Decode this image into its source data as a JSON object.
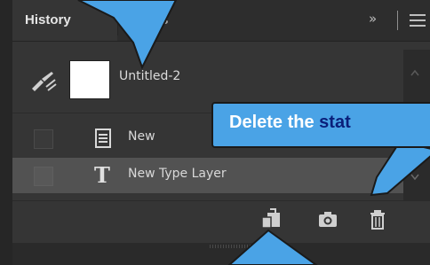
{
  "tabs": {
    "history_label": "History",
    "comments_label": "mments"
  },
  "panel_menu": {
    "collapse_label": "»"
  },
  "snapshot": {
    "name": "Untitled-2"
  },
  "history_items": [
    {
      "label": "New",
      "icon": "document-icon"
    },
    {
      "label": "New Type Layer",
      "icon": "type-tool-icon"
    }
  ],
  "footer_buttons": [
    {
      "name": "new-document-from-state-button",
      "icon": "new-document-icon"
    },
    {
      "name": "new-snapshot-button",
      "icon": "camera-icon"
    },
    {
      "name": "delete-state-button",
      "icon": "trash-icon"
    }
  ],
  "callout": {
    "text_prefix": "Delete the ",
    "text_highlight": "stat"
  },
  "colors": {
    "panel_bg": "#353535",
    "selected_row_bg": "#525252",
    "callout_blue": "#4aa3e6",
    "callout_text_highlight": "#0a1f7a"
  }
}
